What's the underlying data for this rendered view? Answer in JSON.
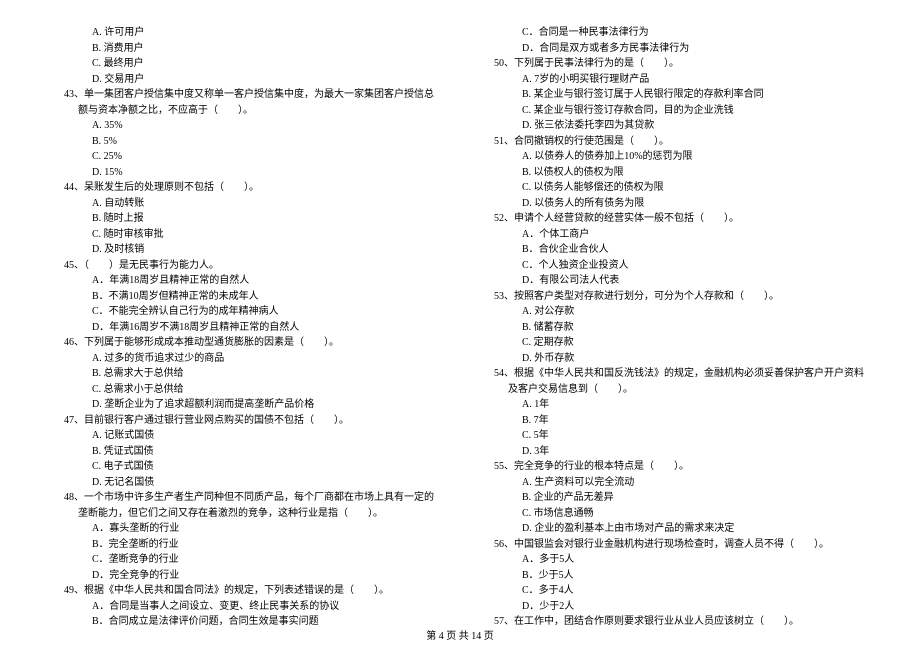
{
  "left": {
    "pre_opts": [
      "A. 许可用户",
      "B. 消费用户",
      "C. 最终用户",
      "D. 交易用户"
    ],
    "q43": "43、单一集团客户授信集中度又称单一客户授信集中度，为最大一家集团客户授信总额与资本净额之比，不应高于（　　）。",
    "q43_opts": [
      "A. 35%",
      "B. 5%",
      "C. 25%",
      "D. 15%"
    ],
    "q44": "44、呆账发生后的处理原则不包括（　　）。",
    "q44_opts": [
      "A. 自动转账",
      "B. 随时上报",
      "C. 随时审核审批",
      "D. 及时核销"
    ],
    "q45": "45、（　　）是无民事行为能力人。",
    "q45_opts": [
      "A．年满18周岁且精神正常的自然人",
      "B．不满10周岁但精神正常的未成年人",
      "C．不能完全辨认自己行为的成年精神病人",
      "D．年满16周岁不满18周岁且精神正常的自然人"
    ],
    "q46": "46、下列属于能够形成成本推动型通货膨胀的因素是（　　）。",
    "q46_opts": [
      "A. 过多的货币追求过少的商品",
      "B. 总需求大于总供给",
      "C. 总需求小于总供给",
      "D. 垄断企业为了追求超额利润而提高垄断产品价格"
    ],
    "q47": "47、目前银行客户通过银行营业网点购买的国债不包括（　　）。",
    "q47_opts": [
      "A. 记账式国债",
      "B. 凭证式国债",
      "C. 电子式国债",
      "D. 无记名国债"
    ],
    "q48": "48、一个市场中许多生产者生产同种但不同质产品，每个厂商都在市场上具有一定的垄断能力，但它们之间又存在着激烈的竞争，这种行业是指（　　）。",
    "q48_opts": [
      "A．寡头垄断的行业",
      "B．完全垄断的行业",
      "C．垄断竞争的行业",
      "D．完全竞争的行业"
    ],
    "q49": "49、根据《中华人民共和国合同法》的规定，下列表述错误的是（　　）。",
    "q49_opts": [
      "A．合同是当事人之间设立、变更、终止民事关系的协议",
      "B．合同成立是法律评价问题，合同生效是事实问题"
    ]
  },
  "right": {
    "q49_cont": [
      "C．合同是一种民事法律行为",
      "D．合同是双方或者多方民事法律行为"
    ],
    "q50": "50、下列属于民事法律行为的是（　　）。",
    "q50_opts": [
      "A. 7岁的小明买银行理财产品",
      "B. 某企业与银行签订属于人民银行限定的存款利率合同",
      "C. 某企业与银行签订存款合同，目的为企业洗钱",
      "D. 张三依法委托李四为其贷款"
    ],
    "q51": "51、合同撤销权的行使范围是（　　）。",
    "q51_opts": [
      "A. 以债券人的债券加上10%的惩罚为限",
      "B. 以债权人的债权为限",
      "C. 以债务人能够偿还的债权为限",
      "D. 以债务人的所有债务为限"
    ],
    "q52": "52、申请个人经营贷款的经营实体一般不包括（　　）。",
    "q52_opts": [
      "A．个体工商户",
      "B．合伙企业合伙人",
      "C．个人独资企业投资人",
      "D．有限公司法人代表"
    ],
    "q53": "53、按照客户类型对存款进行划分，可分为个人存款和（　　）。",
    "q53_opts": [
      "A. 对公存款",
      "B. 储蓄存款",
      "C. 定期存款",
      "D. 外币存款"
    ],
    "q54": "54、根据《中华人民共和国反洗钱法》的规定，金融机构必须妥善保护客户开户资料及客户交易信息到（　　）。",
    "q54_opts": [
      "A. 1年",
      "B. 7年",
      "C. 5年",
      "D. 3年"
    ],
    "q55": "55、完全竞争的行业的根本特点是（　　）。",
    "q55_opts": [
      "A. 生产资料可以完全流动",
      "B. 企业的产品无差异",
      "C. 市场信息通畅",
      "D. 企业的盈利基本上由市场对产品的需求来决定"
    ],
    "q56": "56、中国银监会对银行业金融机构进行现场检查时，调查人员不得（　　）。",
    "q56_opts": [
      "A．多于5人",
      "B．少于5人",
      "C．多于4人",
      "D．少于2人"
    ],
    "q57": "57、在工作中，团结合作原则要求银行业从业人员应该树立（　　）。"
  },
  "footer": "第 4 页 共 14 页"
}
